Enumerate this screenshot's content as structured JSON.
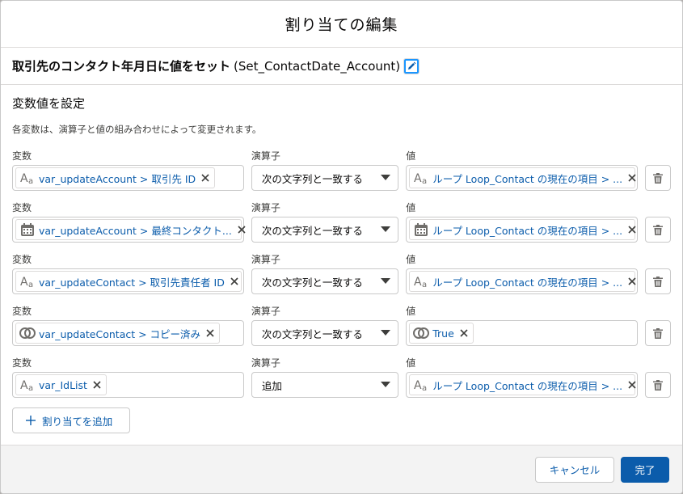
{
  "modal": {
    "title": "割り当ての編集"
  },
  "element": {
    "label": "取引先のコンタクト年月日に値をセット",
    "api_name": "(Set_ContactDate_Account)"
  },
  "section": {
    "title": "変数値を設定",
    "description": "各変数は、演算子と値の組み合わせによって変更されます。"
  },
  "labels": {
    "variable": "変数",
    "operator": "演算子",
    "value": "値"
  },
  "rows": [
    {
      "variable": {
        "icon": "text-icon",
        "text": "var_updateAccount > 取引先 ID"
      },
      "operator": "次の文字列と一致する",
      "value": {
        "icon": "text-icon",
        "text": "ループ Loop_Contact の現在の項目 > ..."
      }
    },
    {
      "variable": {
        "icon": "calendar-icon",
        "text": "var_updateAccount > 最終コンタクト..."
      },
      "operator": "次の文字列と一致する",
      "value": {
        "icon": "calendar-icon",
        "text": "ループ Loop_Contact の現在の項目 > ..."
      }
    },
    {
      "variable": {
        "icon": "text-icon",
        "text": "var_updateContact > 取引先責任者 ID"
      },
      "operator": "次の文字列と一致する",
      "value": {
        "icon": "text-icon",
        "text": "ループ Loop_Contact の現在の項目 > ..."
      }
    },
    {
      "variable": {
        "icon": "toggle-icon",
        "text": "var_updateContact > コピー済み"
      },
      "operator": "次の文字列と一致する",
      "value": {
        "icon": "toggle-icon",
        "text": "True"
      }
    },
    {
      "variable": {
        "icon": "text-icon",
        "text": "var_IdList"
      },
      "operator": "追加",
      "value": {
        "icon": "text-icon",
        "text": "ループ Loop_Contact の現在の項目 > ..."
      }
    }
  ],
  "add_button": {
    "label": "割り当てを追加"
  },
  "footer": {
    "cancel_label": "キャンセル",
    "done_label": "完了"
  },
  "colors": {
    "brand": "#0b5cab",
    "link": "#0b5cab",
    "footer_bg": "#f3f3f3"
  }
}
